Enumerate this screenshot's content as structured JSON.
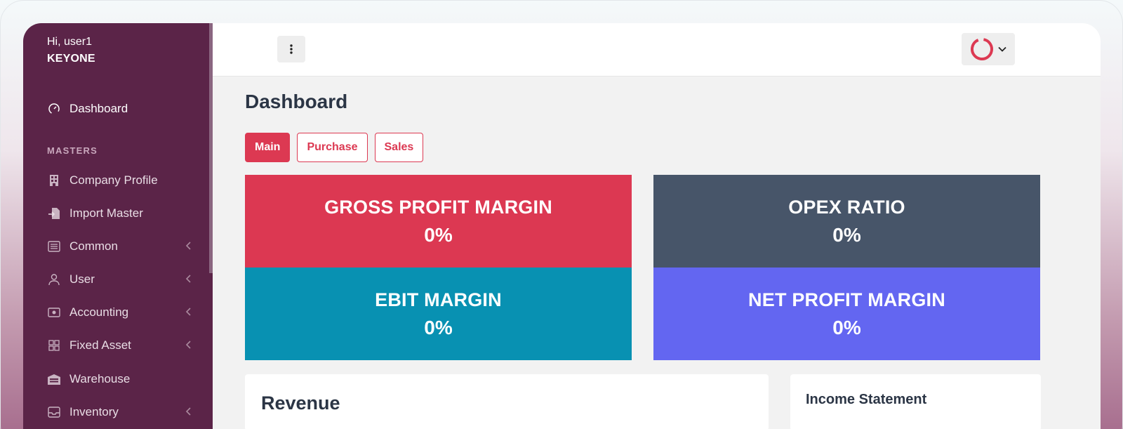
{
  "user": {
    "greeting": "Hi, user1",
    "company": "KEYONE"
  },
  "sidebar": {
    "dashboard": {
      "label": "Dashboard",
      "icon": "dashboard-gauge-icon"
    },
    "section_masters": "MASTERS",
    "items": [
      {
        "label": "Company Profile",
        "icon": "building-icon",
        "expandable": false
      },
      {
        "label": "Import Master",
        "icon": "file-import-icon",
        "expandable": false
      },
      {
        "label": "Common",
        "icon": "list-icon",
        "expandable": true
      },
      {
        "label": "User",
        "icon": "user-icon",
        "expandable": true
      },
      {
        "label": "Accounting",
        "icon": "money-icon",
        "expandable": true
      },
      {
        "label": "Fixed Asset",
        "icon": "grid-icon",
        "expandable": true
      },
      {
        "label": "Warehouse",
        "icon": "warehouse-icon",
        "expandable": false
      },
      {
        "label": "Inventory",
        "icon": "inbox-icon",
        "expandable": true
      }
    ]
  },
  "page": {
    "title": "Dashboard"
  },
  "tabs": [
    {
      "label": "Main",
      "active": true
    },
    {
      "label": "Purchase",
      "active": false
    },
    {
      "label": "Sales",
      "active": false
    }
  ],
  "kpis": {
    "gross_profit_margin": {
      "title": "GROSS PROFIT MARGIN",
      "value": "0%",
      "color": "#dc3852"
    },
    "opex_ratio": {
      "title": "OPEX RATIO",
      "value": "0%",
      "color": "#475569"
    },
    "ebit_margin": {
      "title": "EBIT MARGIN",
      "value": "0%",
      "color": "#0891b2"
    },
    "net_profit_margin": {
      "title": "NET PROFIT MARGIN",
      "value": "0%",
      "color": "#6366f1"
    }
  },
  "cards": {
    "revenue_title": "Revenue",
    "income_statement_title": "Income Statement"
  },
  "colors": {
    "sidebar": "#5b2448",
    "accent": "#dc3952"
  }
}
